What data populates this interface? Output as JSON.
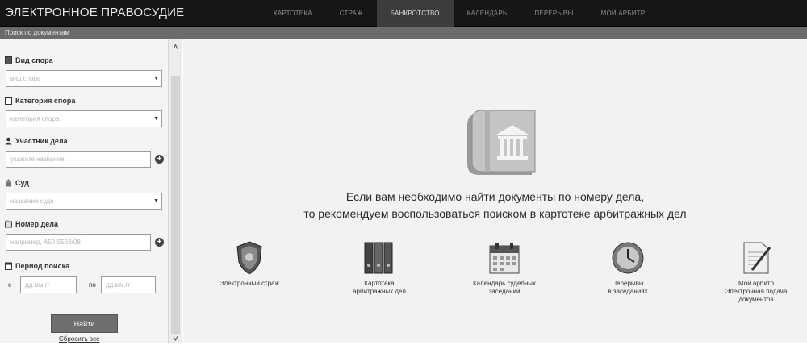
{
  "header": {
    "brand": "ЭЛЕКТРОННОЕ ПРАВОСУДИЕ",
    "nav": [
      "КАРТОТЕКА",
      "СТРАЖ",
      "БАНКРОТСТВО",
      "КАЛЕНДАРЬ",
      "ПЕРЕРЫВЫ",
      "МОЙ АРБИТР"
    ],
    "active_nav_index": 2
  },
  "subbar": {
    "title": "Поиск по документам"
  },
  "sidebar": {
    "dispute_type": {
      "label": "Вид спора",
      "placeholder": "вид спора"
    },
    "dispute_category": {
      "label": "Категория спора",
      "placeholder": "категория спора"
    },
    "participant": {
      "label": "Участник дела",
      "placeholder": "укажите название"
    },
    "court": {
      "label": "Суд",
      "placeholder": "название суда"
    },
    "case_number": {
      "label": "Номер дела",
      "placeholder": "например, А50-5568/08"
    },
    "period": {
      "label": "Период поиска",
      "from_prefix": "с",
      "to_prefix": "по",
      "from_placeholder": "дд.мм.гг",
      "to_placeholder": "дд.мм.гг"
    },
    "find_button": "Найти",
    "reset_link": "Сбросить все"
  },
  "main": {
    "hint_line1": "Если вам необходимо найти документы по номеру дела,",
    "hint_line2": "то рекомендуем воспользоваться поиском в картотеке арбитражных дел",
    "tiles": [
      {
        "line1": "Электронный страж",
        "line2": "",
        "line3": "",
        "icon": "shield-icon"
      },
      {
        "line1": "Картотека",
        "line2": "арбитражных дел",
        "line3": "",
        "icon": "binders-icon"
      },
      {
        "line1": "Календарь судебных",
        "line2": "заседаний",
        "line3": "",
        "icon": "calendar-icon"
      },
      {
        "line1": "Перерывы",
        "line2": "в заседаниях",
        "line3": "",
        "icon": "clock-icon"
      },
      {
        "line1": "Мой арбитр",
        "line2": "Электронная подача",
        "line3": "документов",
        "icon": "document-pen-icon"
      }
    ]
  },
  "colors": {
    "topbar": "#161616",
    "subbar": "#6b6b6b",
    "button": "#6e6e6e"
  }
}
